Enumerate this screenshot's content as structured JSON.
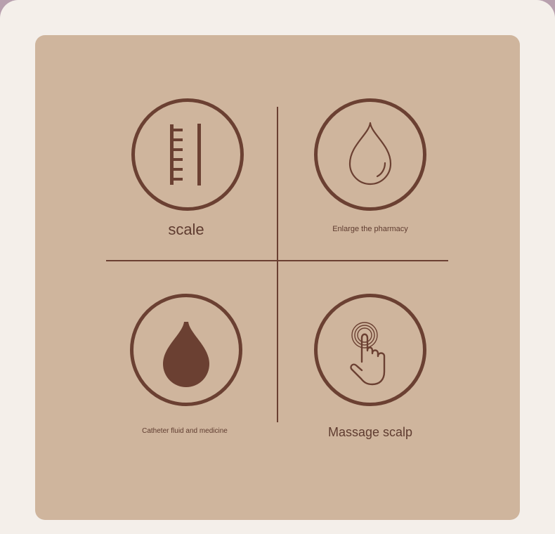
{
  "colors": {
    "background": "#f4efea",
    "card": "#cfb59d",
    "accent": "#6b4032",
    "text": "#5f3c30"
  },
  "tiles": [
    {
      "label": "scale",
      "icon": "ruler-icon"
    },
    {
      "label": "Enlarge the pharmacy",
      "icon": "drop-outline-icon"
    },
    {
      "label": "Catheter fluid and medicine",
      "icon": "drop-filled-icon"
    },
    {
      "label": "Massage scalp",
      "icon": "touch-hand-icon"
    }
  ]
}
